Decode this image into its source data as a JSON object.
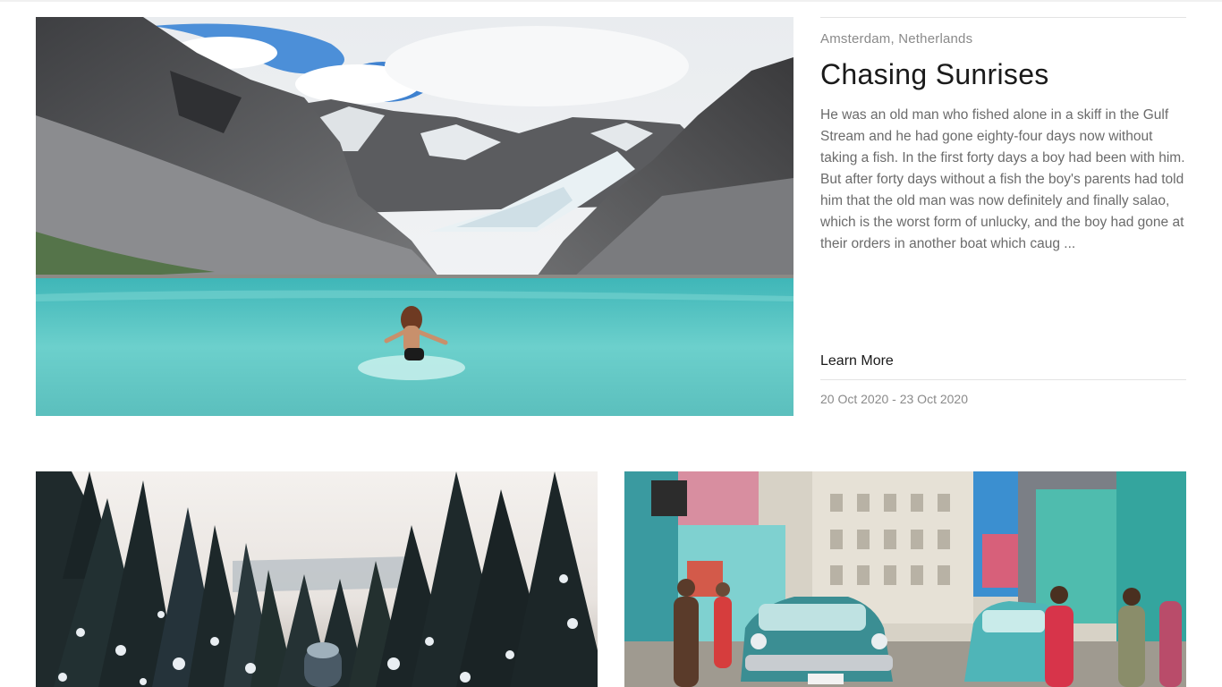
{
  "featured": {
    "image_alt": "Woman wading into a turquoise glacial lake surrounded by mountains",
    "location": "Amsterdam, Netherlands",
    "title": "Chasing Sunrises",
    "excerpt": "He was an old man who fished alone in a skiff in the Gulf Stream and he had gone eighty-four days now without taking a fish. In the first forty days a boy had been with him. But after forty days without a fish the boy's parents had told him that the old man was now definitely and finally salao, which is the worst form of unlucky, and the boy had gone at their orders in another boat which caug ...",
    "learn_more_label": "Learn More",
    "dates": "20 Oct 2020 - 23 Oct 2020"
  },
  "cards": [
    {
      "image_alt": "Snowy pine forest at dusk"
    },
    {
      "image_alt": "Street with classic turquoise cars and colorful buildings"
    }
  ],
  "colors": {
    "title": "#1a1a1a",
    "muted": "#8a8a8a",
    "body": "#6b6b6b",
    "rule": "#e3e3e3",
    "lake": "#5fc4c2"
  }
}
